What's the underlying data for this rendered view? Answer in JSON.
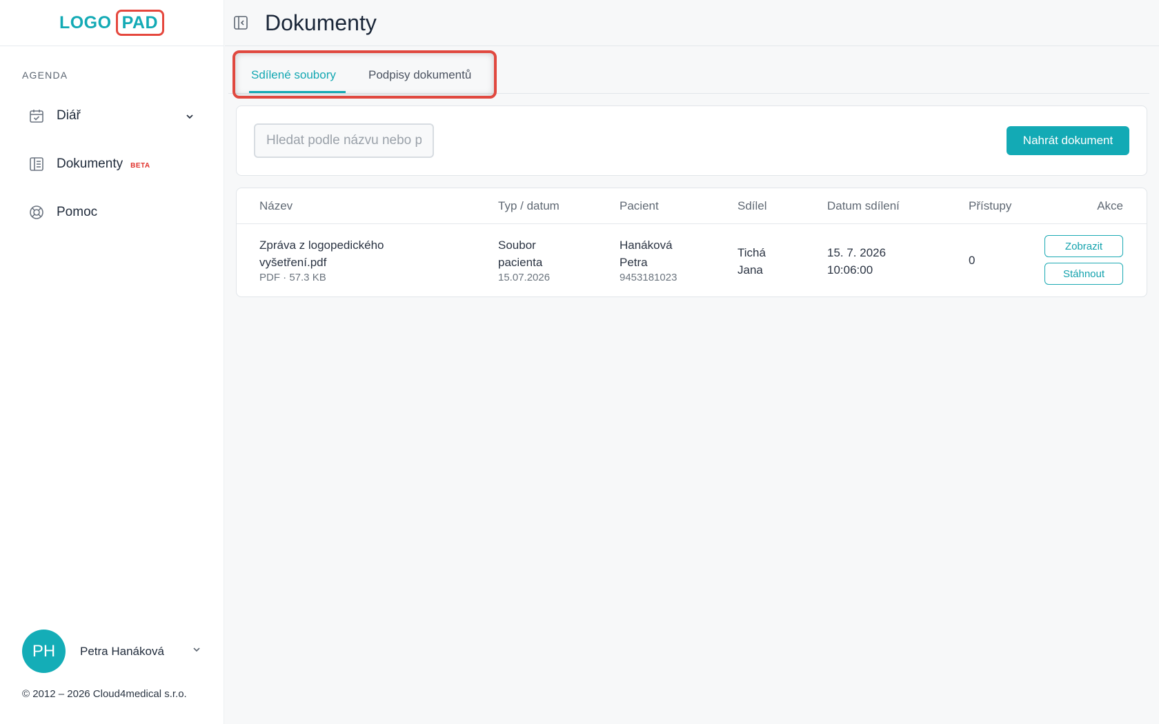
{
  "logo": {
    "part1": "LOGO",
    "part2": "PAD"
  },
  "sidebar": {
    "section_label": "AGENDA",
    "items": [
      {
        "label": "Diář",
        "icon": "calendar-check-icon"
      },
      {
        "label": "Dokumenty",
        "badge": "BETA",
        "icon": "document-list-icon"
      },
      {
        "label": "Pomoc",
        "icon": "lifebuoy-icon"
      }
    ]
  },
  "user": {
    "initials": "PH",
    "name": "Petra Hanáková"
  },
  "footer": {
    "copyright": "© 2012 – 2026 Cloud4medical s.r.o."
  },
  "header": {
    "title": "Dokumenty"
  },
  "tabs": [
    {
      "label": "Sdílené soubory",
      "active": true
    },
    {
      "label": "Podpisy dokumentů",
      "active": false
    }
  ],
  "search": {
    "placeholder": "Hledat podle názvu nebo pacienta",
    "value": ""
  },
  "toolbar": {
    "upload_label": "Nahrát dokument"
  },
  "table": {
    "columns": [
      "Název",
      "Typ / datum",
      "Pacient",
      "Sdílel",
      "Datum sdílení",
      "Přístupy",
      "Akce"
    ],
    "rows": [
      {
        "name_line1": "Zpráva z logopedického",
        "name_line2": "vyšetření.pdf",
        "meta": "PDF · 57.3 KB",
        "type_line1": "Soubor",
        "type_line2": "pacienta",
        "type_date": "15.07.2026",
        "patient_line1": "Hanáková",
        "patient_line2": "Petra",
        "patient_id": "9453181023",
        "shared_by_line1": "Tichá",
        "shared_by_line2": "Jana",
        "shared_date": "15. 7. 2026",
        "shared_time": "10:06:00",
        "access_count": "0",
        "action_view": "Zobrazit",
        "action_download": "Stáhnout"
      }
    ]
  },
  "colors": {
    "accent": "#13aab5",
    "highlight": "#e0483f",
    "beta": "#e0302a"
  }
}
